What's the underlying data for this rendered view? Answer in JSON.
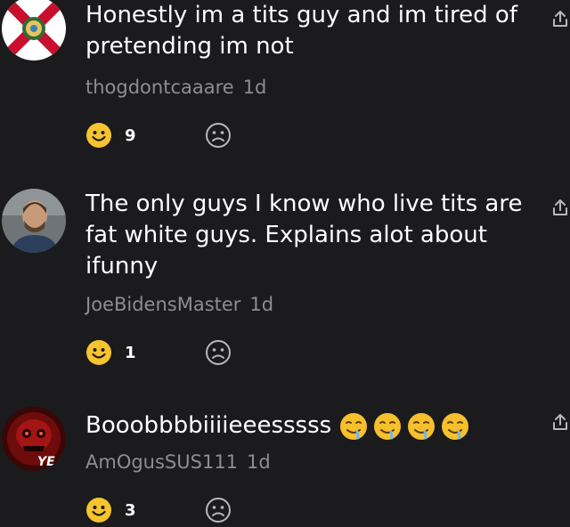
{
  "comments": [
    {
      "text": "Honestly im a tits guy and im tired of pretending im not",
      "author": "thogdontcaaare",
      "time": "1d",
      "smile_count": "9",
      "avatar_icon": "florida-flag-avatar"
    },
    {
      "text": "The only guys I know who live tits are fat white guys. Explains alot about ifunny",
      "author": "JoeBidensMaster",
      "time": "1d",
      "smile_count": "1",
      "avatar_icon": "man-portrait-avatar"
    },
    {
      "text": "Booobbbbiiiieeesssss",
      "author": "AmOgusSUS111",
      "time": "1d",
      "smile_count": "3",
      "avatar_icon": "red-skull-avatar",
      "emoji": [
        "drooling-face-emoji",
        "drooling-face-emoji",
        "drooling-face-emoji",
        "drooling-face-emoji"
      ]
    }
  ],
  "colors": {
    "background": "#1b1b1d",
    "smile_yellow": "#f6c42d",
    "muted_text": "#8d8d92"
  }
}
